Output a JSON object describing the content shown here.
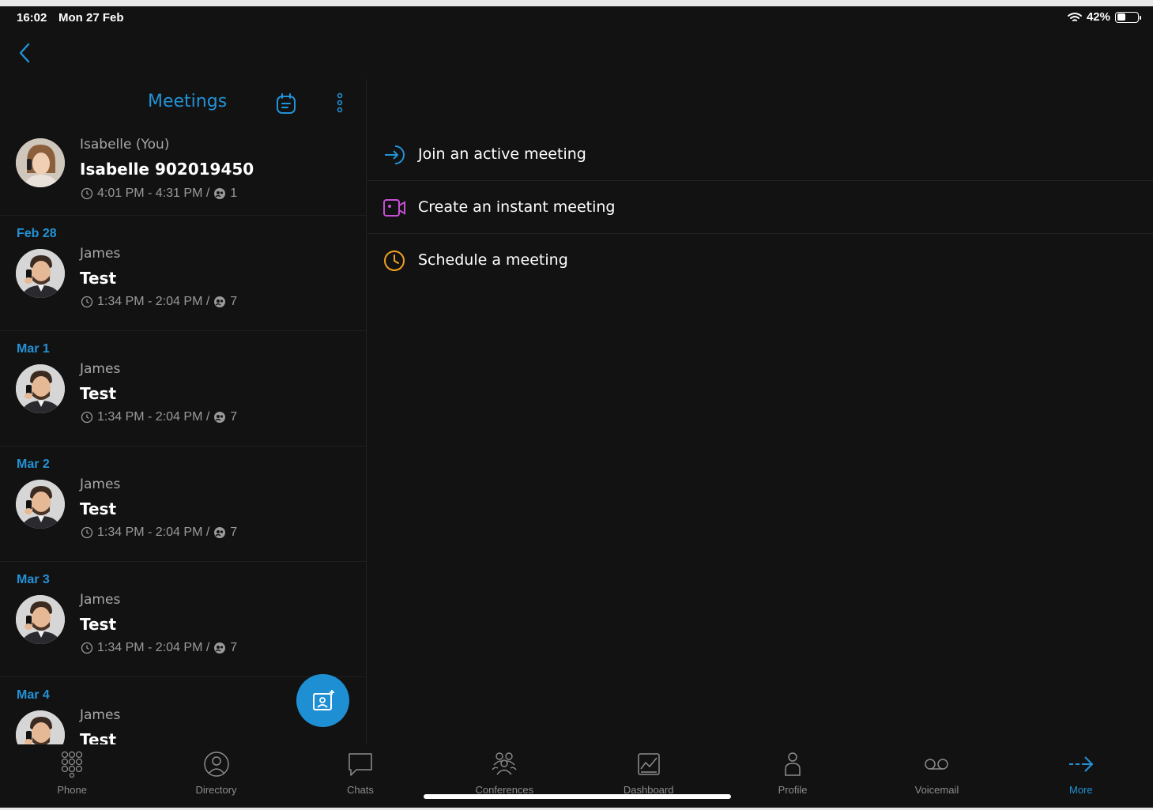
{
  "status_bar": {
    "time": "16:02",
    "date": "Mon 27 Feb",
    "battery": "42%",
    "battery_level": 0.42
  },
  "header": {
    "title": "Meetings",
    "back_icon": "chevron-left-icon",
    "calendar_icon": "calendar-icon",
    "menu_icon": "more-vert-icon"
  },
  "current_meeting": {
    "organizer": "Isabelle (You)",
    "subject": "Isabelle 902019450",
    "time": "4:01 PM - 4:31 PM /",
    "participants": "1"
  },
  "groups": [
    {
      "date": "Feb 28",
      "organizer": "James",
      "subject": "Test",
      "time": "1:34 PM - 2:04 PM /",
      "participants": "7"
    },
    {
      "date": "Mar 1",
      "organizer": "James",
      "subject": "Test",
      "time": "1:34 PM - 2:04 PM /",
      "participants": "7"
    },
    {
      "date": "Mar 2",
      "organizer": "James",
      "subject": "Test",
      "time": "1:34 PM - 2:04 PM /",
      "participants": "7"
    },
    {
      "date": "Mar 3",
      "organizer": "James",
      "subject": "Test",
      "time": "1:34 PM - 2:04 PM /",
      "participants": "7"
    },
    {
      "date": "Mar 4",
      "organizer": "James",
      "subject": "Test",
      "time": "",
      "participants": ""
    }
  ],
  "actions": [
    {
      "label": "Join an active meeting",
      "icon": "join-arrow-icon",
      "color": "#2392d6"
    },
    {
      "label": "Create an instant meeting",
      "icon": "video-camera-icon",
      "color": "#c74fd8"
    },
    {
      "label": "Schedule a meeting",
      "icon": "clock-icon",
      "color": "#f0a020"
    }
  ],
  "nav": [
    {
      "label": "Phone",
      "icon": "dialpad-icon"
    },
    {
      "label": "Directory",
      "icon": "directory-icon"
    },
    {
      "label": "Chats",
      "icon": "chat-bubble-icon"
    },
    {
      "label": "Conferences",
      "icon": "conferences-icon"
    },
    {
      "label": "Dashboard",
      "icon": "dashboard-icon"
    },
    {
      "label": "Profile",
      "icon": "profile-icon"
    },
    {
      "label": "Voicemail",
      "icon": "voicemail-icon"
    },
    {
      "label": "More",
      "icon": "more-arrow-icon",
      "active": true
    }
  ],
  "colors": {
    "accent": "#2392d6",
    "background": "#121212"
  }
}
